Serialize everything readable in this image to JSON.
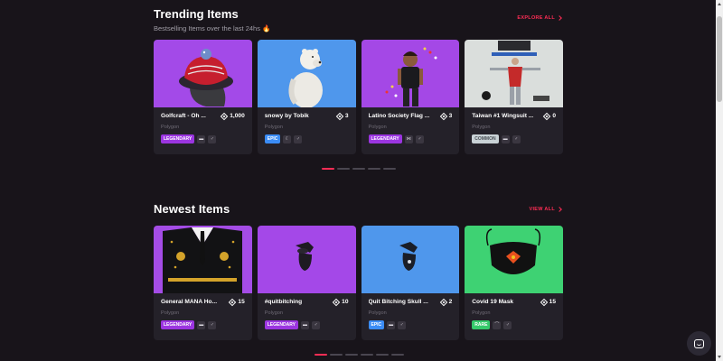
{
  "trending": {
    "title": "Trending Items",
    "subtitle": "Bestselling Items over the last 24hs",
    "subtitle_emoji": "🔥",
    "view_all": "EXPLORE ALL",
    "items": [
      {
        "name": "Golfcraft - Oh ...",
        "price": "1,000",
        "network": "Polygon",
        "rarity": "LEGENDARY",
        "rarity_bg": "#9b35e0",
        "rarity_fg": "#ffffff",
        "bg": "#a34ae8",
        "icons": [
          "▬",
          "♂"
        ]
      },
      {
        "name": "snowy by Tobik",
        "price": "3",
        "network": "Polygon",
        "rarity": "EPIC",
        "rarity_bg": "#3b8cf5",
        "rarity_fg": "#ffffff",
        "bg": "#4f97ec",
        "icons": [
          "☾",
          "♂"
        ]
      },
      {
        "name": "Latino Society Flag ...",
        "price": "3",
        "network": "Polygon",
        "rarity": "LEGENDARY",
        "rarity_bg": "#9b35e0",
        "rarity_fg": "#ffffff",
        "bg": "#a448e6",
        "icons": [
          "⋈",
          "♂"
        ]
      },
      {
        "name": "Taiwan #1 Wingsuit ...",
        "price": "0",
        "network": "Polygon",
        "rarity": "COMMON",
        "rarity_bg": "#c9d2d6",
        "rarity_fg": "#4a4f55",
        "bg": "#dadedc",
        "icons": [
          "▬",
          "♂"
        ]
      }
    ],
    "dots": 5,
    "active_dot": 0
  },
  "newest": {
    "title": "Newest Items",
    "view_all": "VIEW ALL",
    "items": [
      {
        "name": "General MANA Ho...",
        "price": "15",
        "network": "Polygon",
        "rarity": "LEGENDARY",
        "rarity_bg": "#9b35e0",
        "rarity_fg": "#ffffff",
        "bg": "#a44ce6",
        "icons": [
          "▬",
          "♂"
        ]
      },
      {
        "name": "#quitbitching",
        "price": "10",
        "network": "Polygon",
        "rarity": "LEGENDARY",
        "rarity_bg": "#9b35e0",
        "rarity_fg": "#ffffff",
        "bg": "#a448e8",
        "icons": [
          "▬",
          "♂"
        ]
      },
      {
        "name": "Quit Bitching Skull ...",
        "price": "2",
        "network": "Polygon",
        "rarity": "EPIC",
        "rarity_bg": "#3b8cf5",
        "rarity_fg": "#ffffff",
        "bg": "#4f97ec",
        "icons": [
          "▬",
          "♂"
        ]
      },
      {
        "name": "Covid 19 Mask",
        "price": "15",
        "network": "Polygon",
        "rarity": "RARE",
        "rarity_bg": "#35c96b",
        "rarity_fg": "#ffffff",
        "bg": "#3ed273",
        "icons": [
          "⌒",
          "♂"
        ]
      }
    ],
    "dots": 6,
    "active_dot": 0
  }
}
